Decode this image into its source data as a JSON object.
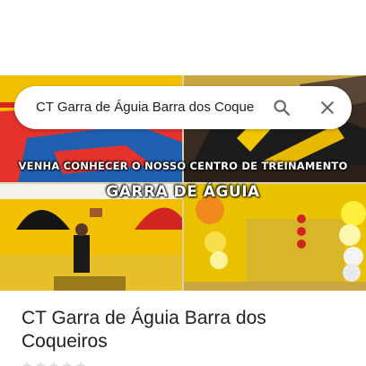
{
  "search": {
    "query": "CT Garra de Águia Barra dos Coque"
  },
  "hero": {
    "tagline": "VENHA CONHECER O NOSSO CENTRO DE TREINAMENTO",
    "brand": "GARRA DE ÁGUIA"
  },
  "place": {
    "name": "CT Garra de Águia Barra dos Coqueiros"
  },
  "icons": {
    "search": "search-icon",
    "close": "close-icon",
    "stars": "star-icon"
  },
  "colors": {
    "text_primary": "#202124",
    "icon_gray": "#5f6368",
    "star_empty": "#dadce0"
  }
}
